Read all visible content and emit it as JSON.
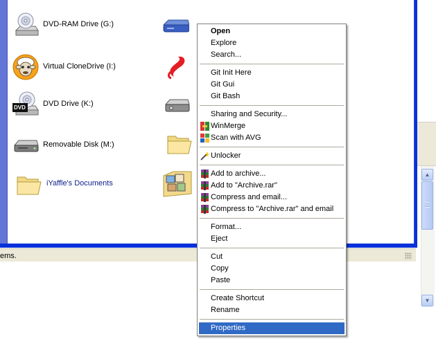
{
  "status_bar": {
    "text": "ems."
  },
  "drives": [
    {
      "name": "dvd-ram-drive",
      "label": "DVD-RAM Drive (G:)"
    },
    {
      "name": "virtual-clonedrive",
      "label": "Virtual CloneDrive (I:)"
    },
    {
      "name": "dvd-drive",
      "label": "DVD Drive (K:)",
      "badge": "DVD"
    },
    {
      "name": "removable-disk",
      "label": "Removable Disk (M:)"
    },
    {
      "name": "documents-folder",
      "label": "iYaffle's Documents"
    }
  ],
  "context_menu": {
    "selected": "Properties",
    "groups": [
      [
        {
          "label": "Open",
          "bold": true
        },
        {
          "label": "Explore"
        },
        {
          "label": "Search..."
        }
      ],
      [
        {
          "label": "Git Init Here"
        },
        {
          "label": "Git Gui"
        },
        {
          "label": "Git Bash"
        }
      ],
      [
        {
          "label": "Sharing and Security..."
        },
        {
          "label": "WinMerge",
          "icon": "winmerge-icon"
        },
        {
          "label": "Scan with AVG",
          "icon": "avg-icon"
        }
      ],
      [
        {
          "label": "Unlocker",
          "icon": "unlocker-wand-icon"
        }
      ],
      [
        {
          "label": "Add to archive...",
          "icon": "winrar-icon"
        },
        {
          "label": "Add to \"Archive.rar\"",
          "icon": "winrar-icon"
        },
        {
          "label": "Compress and email...",
          "icon": "winrar-icon"
        },
        {
          "label": "Compress to \"Archive.rar\" and email",
          "icon": "winrar-icon"
        }
      ],
      [
        {
          "label": "Format..."
        },
        {
          "label": "Eject"
        }
      ],
      [
        {
          "label": "Cut"
        },
        {
          "label": "Copy"
        },
        {
          "label": "Paste"
        }
      ],
      [
        {
          "label": "Create Shortcut"
        },
        {
          "label": "Rename"
        }
      ],
      [
        {
          "label": "Properties"
        }
      ]
    ]
  },
  "colors": {
    "selection": "#316ac5",
    "xp_blue": "#0831d9",
    "menu_separator": "#aca899"
  }
}
